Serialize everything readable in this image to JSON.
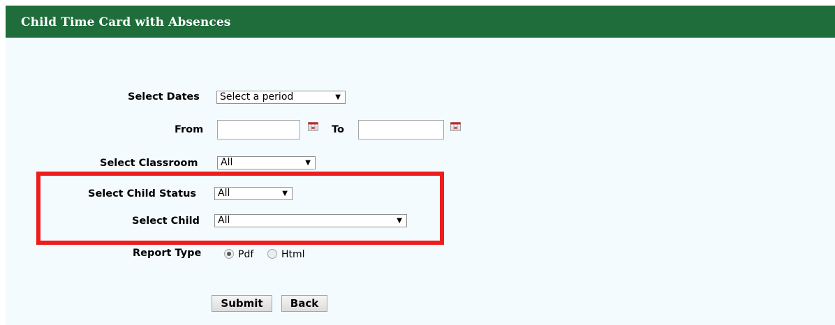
{
  "header": {
    "title": "Child Time Card with Absences"
  },
  "form": {
    "dates": {
      "label": "Select Dates",
      "value": "Select a period"
    },
    "from": {
      "label": "From",
      "value": ""
    },
    "to": {
      "label": "To",
      "value": ""
    },
    "classroom": {
      "label": "Select Classroom",
      "value": "All"
    },
    "child_status": {
      "label": "Select Child Status",
      "value": "All"
    },
    "child": {
      "label": "Select Child",
      "value": "All"
    },
    "report_type": {
      "label": "Report Type",
      "options": [
        {
          "label": "Pdf",
          "selected": true
        },
        {
          "label": "Html",
          "selected": false
        }
      ]
    }
  },
  "buttons": {
    "submit": "Submit",
    "back": "Back"
  },
  "colors": {
    "header_bg": "#1f6d3a",
    "highlight": "#ee1c1c",
    "panel_bg": "#f4fbfe"
  }
}
